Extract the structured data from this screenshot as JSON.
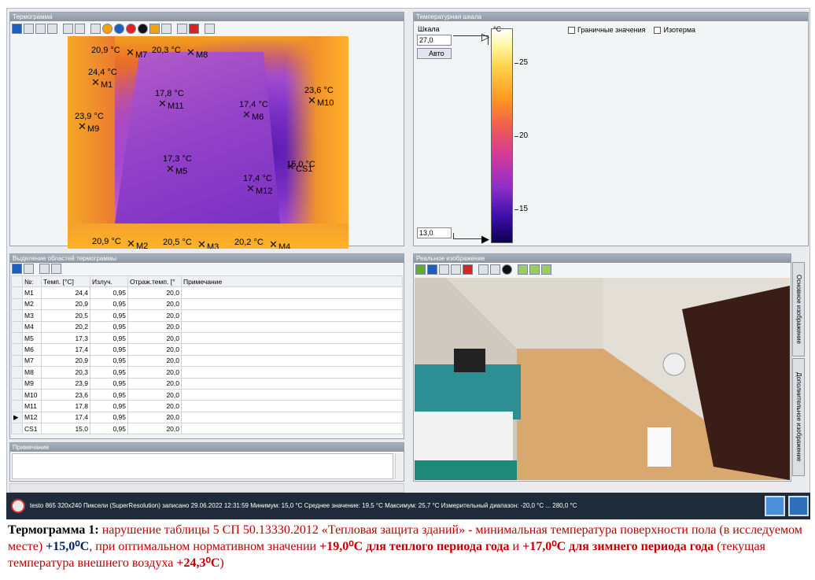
{
  "thermogram": {
    "title": "Термограмма",
    "markers": [
      {
        "id": "M1",
        "t": "24,4 °C"
      },
      {
        "id": "M2",
        "t": "20,9 °C"
      },
      {
        "id": "M3",
        "t": "20,5 °C"
      },
      {
        "id": "M4",
        "t": "20,2 °C"
      },
      {
        "id": "M5",
        "t": "17,3 °C"
      },
      {
        "id": "M6",
        "t": "17,4 °C"
      },
      {
        "id": "M7",
        "t": "20,9 °C"
      },
      {
        "id": "M8",
        "t": "20,3 °C"
      },
      {
        "id": "M9",
        "t": "23,9 °C"
      },
      {
        "id": "M10",
        "t": "23,6 °C"
      },
      {
        "id": "M11",
        "t": "17,8 °C"
      },
      {
        "id": "M12",
        "t": "17,4 °C"
      },
      {
        "id": "CS1",
        "t": "15,0 °C"
      }
    ]
  },
  "tempscale": {
    "title": "Температурная шкала",
    "scale_label": "Шкала",
    "max_value": "27,0",
    "min_value": "13,0",
    "auto_label": "Авто",
    "unit": "°C",
    "limit_label": "Граничные значения",
    "isotherm_label": "Изотерма",
    "ticks": [
      "25",
      "20",
      "15"
    ]
  },
  "regions": {
    "title": "Выделение областей термограммы",
    "headers": [
      "№:",
      "Темп. [°C]",
      "Излуч.",
      "Отраж.темп. [°",
      "Примечание"
    ],
    "rows": [
      [
        "M1",
        "24,4",
        "0,95",
        "20,0"
      ],
      [
        "M2",
        "20,9",
        "0,95",
        "20,0"
      ],
      [
        "M3",
        "20,5",
        "0,95",
        "20,0"
      ],
      [
        "M4",
        "20,2",
        "0,95",
        "20,0"
      ],
      [
        "M5",
        "17,3",
        "0,95",
        "20,0"
      ],
      [
        "M6",
        "17,4",
        "0,95",
        "20,0"
      ],
      [
        "M7",
        "20,9",
        "0,95",
        "20,0"
      ],
      [
        "M8",
        "20,3",
        "0,95",
        "20,0"
      ],
      [
        "M9",
        "23,9",
        "0,95",
        "20,0"
      ],
      [
        "M10",
        "23,6",
        "0,95",
        "20,0"
      ],
      [
        "M11",
        "17,8",
        "0,95",
        "20,0"
      ],
      [
        "M12",
        "17,4",
        "0,95",
        "20,0"
      ],
      [
        "CS1",
        "15,0",
        "0,95",
        "20,0"
      ]
    ]
  },
  "note": {
    "title": "Примечание"
  },
  "photo": {
    "title": "Реальное изображение",
    "tab1": "Основное изображение",
    "tab2": "Дополнительное изображение"
  },
  "status": {
    "text": "testo 865 320x240 Пиксели (SuperResolution) записано 29.06.2022 12:31:59 Минимум: 15,0 °C Среднее значение: 19,5 °C Максимум: 25,7 °C Измерительный диапазон: -20,0 °C ... 280,0 °C"
  },
  "caption": {
    "a": "Термограмма  1:",
    "b": " нарушение таблицы 5 СП 50.13330.2012 «Тепловая защита зданий» - минимальная температура поверхности пола (в исследуемом месте) ",
    "c": "+15,0⁰С",
    "d": ", при оптимальном нормативном значении ",
    "e": "+19,0⁰С для теплого периода года",
    "f": " и ",
    "g": "+17,0⁰С для зимнего периода года",
    "h": " (текущая температура внешнего воздуха ",
    "i": "+24,3⁰С",
    "j": ")"
  }
}
